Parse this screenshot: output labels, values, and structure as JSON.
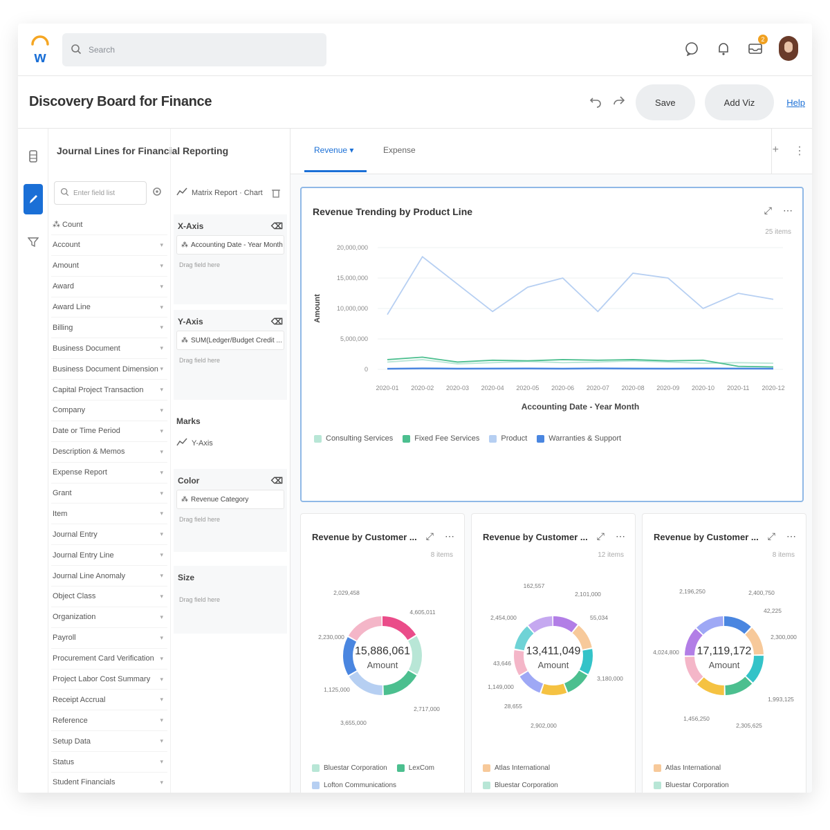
{
  "search": {
    "placeholder": "Search"
  },
  "top_icons": [
    "chat-icon",
    "bell-icon",
    "inbox-icon"
  ],
  "inbox_badge": "2",
  "header": {
    "title": "Discovery Board for Finance",
    "more": "···",
    "save_label": "Save",
    "addviz_label": "Add Viz",
    "help_label": "Help"
  },
  "fields_panel": {
    "title": "Journal Lines for Financial Reporting",
    "search_placeholder": "Enter field list",
    "fields": [
      "Count",
      "Account",
      "Amount",
      "Award",
      "Award Line",
      "Billing",
      "Business Document",
      "Business Document Dimension",
      "Capital Project Transaction",
      "Company",
      "Date or Time Period",
      "Description & Memos",
      "Expense Report",
      "Grant",
      "Item",
      "Journal Entry",
      "Journal Entry Line",
      "Journal Line Anomaly",
      "Object Class",
      "Organization",
      "Payroll",
      "Procurement Card Verification",
      "Project Labor Cost Summary",
      "Receipt Accrual",
      "Reference",
      "Setup Data",
      "Status",
      "Student Financials"
    ]
  },
  "config_panel": {
    "chart_type": "Matrix Report · Chart",
    "x_axis_label": "X-Axis",
    "x_axis_field": "Accounting Date - Year Month",
    "y_axis_label": "Y-Axis",
    "y_axis_field": "SUM(Ledger/Budget Credit ...",
    "drop_hint": "Drag field here",
    "marks_label": "Marks",
    "marks_value": "Y-Axis",
    "color_label": "Color",
    "color_field": "Revenue Category",
    "size_label": "Size"
  },
  "tabs": {
    "revenue": "Revenue ▾",
    "expense": "Expense",
    "add": "+",
    "more": "⋮"
  },
  "line_card": {
    "title": "Revenue Trending by Product Line",
    "count": "25 items"
  },
  "donuts": [
    {
      "title": "Revenue by Customer ...",
      "count": "8 items",
      "total": "15,886,061",
      "total_label": "Amount",
      "labels": [
        "2,029,458",
        "4,605,011",
        "2,230,000",
        "1,125,000",
        "3,655,000",
        "2,717,000"
      ],
      "legend": [
        "Bluestar Corporation",
        "LexCom",
        "Lofton Communications"
      ]
    },
    {
      "title": "Revenue by Customer ...",
      "count": "12 items",
      "total": "13,411,049",
      "total_label": "Amount",
      "labels": [
        "162,557",
        "2,101,000",
        "55,034",
        "2,454,000",
        "3,180,000",
        "43,646",
        "1,149,000",
        "28,655",
        "2,902,000"
      ],
      "legend": [
        "Atlas International",
        "Bluestar Corporation"
      ]
    },
    {
      "title": "Revenue by Customer ...",
      "count": "8 items",
      "total": "17,119,172",
      "total_label": "Amount",
      "labels": [
        "2,196,250",
        "2,400,750",
        "42,225",
        "2,300,000",
        "4,024,800",
        "1,993,125",
        "1,456,250",
        "2,305,625"
      ],
      "legend": [
        "Atlas International",
        "Bluestar Corporation"
      ]
    }
  ],
  "colors": {
    "accent": "#1a6fd6",
    "consulting": "#b8e6d6",
    "fixed_fee": "#4cbf8f",
    "product": "#b6cff2",
    "warranties": "#4a86e0"
  },
  "chart_data": {
    "type": "line",
    "x": [
      "2020-01",
      "2020-02",
      "2020-03",
      "2020-04",
      "2020-05",
      "2020-06",
      "2020-07",
      "2020-08",
      "2020-09",
      "2020-10",
      "2020-11",
      "2020-12"
    ],
    "series": [
      {
        "name": "Consulting Services",
        "values": [
          1200000,
          1600000,
          900000,
          1100000,
          1300000,
          1100000,
          1200000,
          1400000,
          1200000,
          1000000,
          1100000,
          1000000
        ]
      },
      {
        "name": "Fixed Fee Services",
        "values": [
          1600000,
          2000000,
          1200000,
          1500000,
          1400000,
          1600000,
          1500000,
          1600000,
          1400000,
          1500000,
          500000,
          400000
        ]
      },
      {
        "name": "Product",
        "values": [
          9000000,
          18500000,
          14000000,
          9500000,
          13500000,
          15000000,
          9500000,
          15800000,
          15000000,
          10000000,
          12500000,
          11500000
        ]
      },
      {
        "name": "Warranties & Support",
        "values": [
          100000,
          150000,
          120000,
          130000,
          140000,
          120000,
          150000,
          130000,
          120000,
          140000,
          130000,
          120000
        ]
      }
    ],
    "ylim": [
      0,
      20000000
    ],
    "yticks": [
      "20,000,000",
      "15,000,000",
      "10,000,000",
      "5,000,000",
      "0"
    ],
    "xlabel": "Accounting Date - Year Month",
    "ylabel": "Amount",
    "legend_position": "bottom-left"
  }
}
